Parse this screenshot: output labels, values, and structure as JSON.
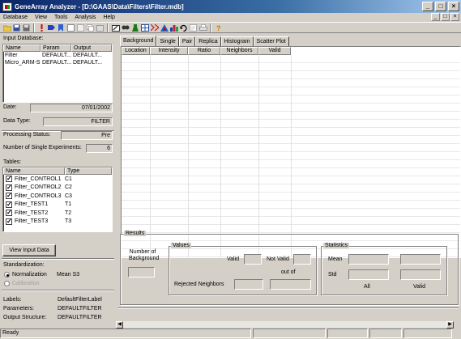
{
  "window": {
    "title": "GeneArray Analyzer - [D:\\GAAS\\Data\\Filters\\Filter.mdb]",
    "min": "_",
    "max": "□",
    "close": "×"
  },
  "menu": [
    "Database",
    "View",
    "Tools",
    "Analysis",
    "Help"
  ],
  "mdi_buttons": [
    "_",
    "□",
    "×"
  ],
  "toolbar_icons": [
    "open-folder-icon",
    "save-icon",
    "save-all-icon",
    "red-mark-icon",
    "blue-tag-icon",
    "bookmark-icon",
    "import-icon",
    "export-icon",
    "copy-icon",
    "paste-icon",
    "edit-icon",
    "find-icon",
    "flask-icon",
    "grid-icon",
    "filter-icon",
    "analyze-icon",
    "chart-icon",
    "undo-icon",
    "properties-icon",
    "print-icon",
    "help-icon"
  ],
  "input_database": {
    "label": "Input Database:",
    "columns": [
      "Name",
      "Param",
      "Output"
    ],
    "rows": [
      [
        "Filter",
        "DEFAULT...",
        "DEFAULT..."
      ],
      [
        "Micro_ARM-SE",
        "DEFAULT...",
        "DEFAULT..."
      ]
    ]
  },
  "info": {
    "date_label": "Date:",
    "date_value": "07/01/2002",
    "type_label": "Data Type:",
    "type_value": "FILTER",
    "status_label": "Processing Status:",
    "status_value": "Pre",
    "count_label": "Number of Single Experiments:",
    "count_value": "6"
  },
  "tables": {
    "label": "Tables:",
    "columns": [
      "Name",
      "Type"
    ],
    "rows": [
      {
        "name": "Filter_CONTROL1",
        "type": "C1",
        "checked": true
      },
      {
        "name": "Filter_CONTROL2",
        "type": "C2",
        "checked": true
      },
      {
        "name": "Filter_CONTROL3",
        "type": "C3",
        "checked": true
      },
      {
        "name": "Filter_TEST1",
        "type": "T1",
        "checked": true
      },
      {
        "name": "Filter_TEST2",
        "type": "T2",
        "checked": true
      },
      {
        "name": "Filter_TEST3",
        "type": "T3",
        "checked": true
      }
    ]
  },
  "view_button": "View Input Data",
  "standardization": {
    "label": "Standardization:",
    "option1": "Normalization",
    "option1_value": "Mean S3",
    "option2": "Calibration"
  },
  "meta": {
    "labels_label": "Labels:",
    "labels_value": "DefaultFilterLabel",
    "params_label": "Parameters:",
    "params_value": "DEFAULTFILTER",
    "output_label": "Output Structure:",
    "output_value": "DEFAULTFILTER"
  },
  "tabs": [
    "Background",
    "Single",
    "Pair",
    "Replica",
    "Histogram",
    "Scatter Plot"
  ],
  "grid_columns": [
    "Location",
    "Intensity",
    "Ratio",
    "Neighbors",
    "Valid"
  ],
  "results": {
    "title": "Results",
    "num_bg": "Number of Background",
    "values_title": "Values",
    "valid": "Valid",
    "not_valid": "Not Valid",
    "out_of": "out of",
    "rejected": "Rejected Neighbors",
    "stats_title": "Statistics",
    "mean": "Mean",
    "std": "Std",
    "all": "All",
    "valid2": "Valid"
  },
  "status": "Ready"
}
